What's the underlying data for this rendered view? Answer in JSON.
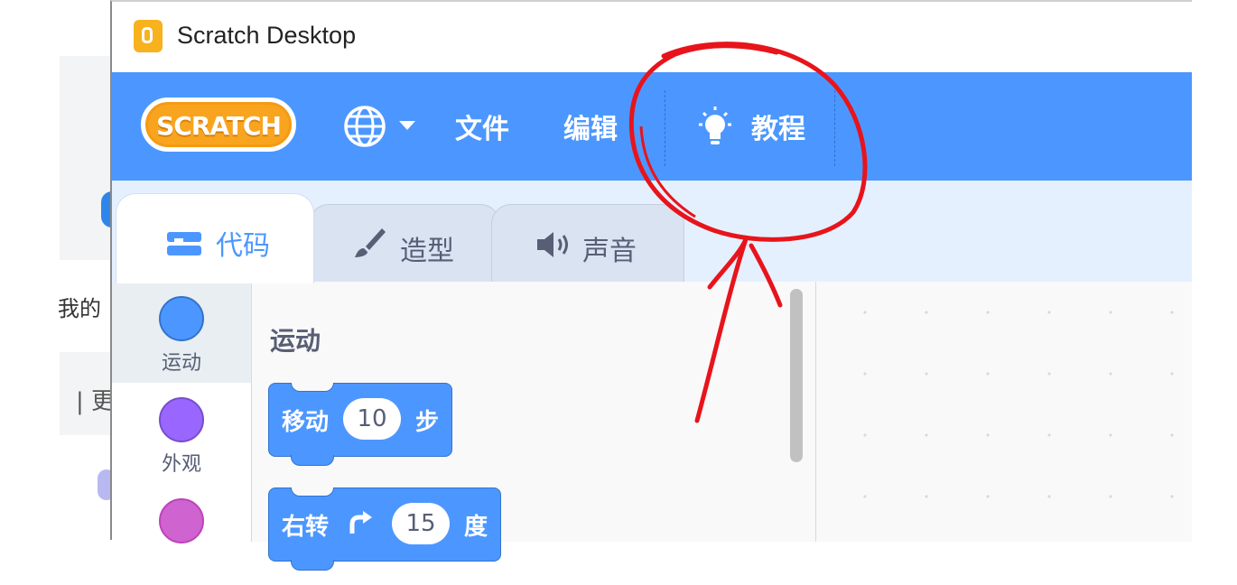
{
  "background": {
    "text_fragment_1": "我的",
    "text_fragment_2": "| 更"
  },
  "window": {
    "title": "Scratch Desktop",
    "icon": "scratch-app-icon"
  },
  "menubar": {
    "logo_text": "SCRATCH",
    "language_icon": "globe-icon",
    "file_label": "文件",
    "edit_label": "编辑",
    "tutorials_icon": "lightbulb-icon",
    "tutorials_label": "教程"
  },
  "tabs": [
    {
      "label": "代码",
      "icon": "code-blocks-icon",
      "active": true
    },
    {
      "label": "造型",
      "icon": "paintbrush-icon",
      "active": false
    },
    {
      "label": "声音",
      "icon": "speaker-icon",
      "active": false
    }
  ],
  "categories": [
    {
      "label": "运动",
      "color": "#4c97ff",
      "active": true
    },
    {
      "label": "外观",
      "color": "#9966ff",
      "active": false
    },
    {
      "label": "",
      "color": "#cf63cf",
      "active": false
    }
  ],
  "palette": {
    "heading": "运动",
    "blocks": [
      {
        "pre": "移动",
        "value": "10",
        "post": "步"
      },
      {
        "pre": "右转",
        "icon": "rotate-clockwise-icon",
        "value": "15",
        "post": "度"
      }
    ]
  },
  "colors": {
    "menubar": "#4c97ff",
    "motion": "#4c97ff",
    "looks": "#9966ff",
    "sound": "#cf63cf",
    "annotation": "#e8141b"
  }
}
